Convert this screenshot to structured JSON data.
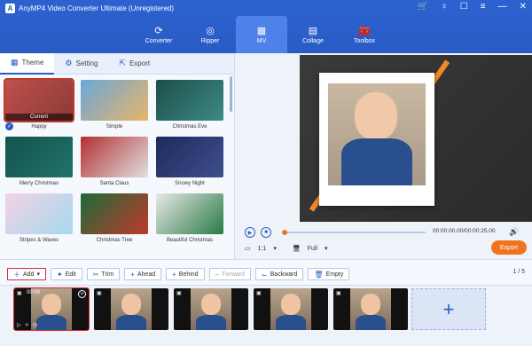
{
  "app": {
    "title": "AnyMP4 Video Converter Ultimate (Unregistered)",
    "logo_letter": "A"
  },
  "window_controls": [
    "cart-icon",
    "account-icon",
    "chat-icon",
    "menu-icon",
    "minimize-icon",
    "close-icon"
  ],
  "nav": {
    "items": [
      {
        "label": "Converter",
        "icon": "converter-icon"
      },
      {
        "label": "Ripper",
        "icon": "ripper-icon"
      },
      {
        "label": "MV",
        "icon": "mv-icon",
        "active": true
      },
      {
        "label": "Collage",
        "icon": "collage-icon"
      },
      {
        "label": "Toolbox",
        "icon": "toolbox-icon"
      }
    ]
  },
  "tabs": [
    {
      "label": "Theme",
      "active": true
    },
    {
      "label": "Setting"
    },
    {
      "label": "Export"
    }
  ],
  "themes": [
    {
      "name": "Happy",
      "current": true,
      "current_label": "Current",
      "colors": [
        "#c0504d",
        "#8a3a35"
      ]
    },
    {
      "name": "Simple",
      "colors": [
        "#6aa7d8",
        "#e8b56a"
      ]
    },
    {
      "name": "Christmas Eve",
      "colors": [
        "#1e4d4a",
        "#3d8b84"
      ]
    },
    {
      "name": "Merry Christmas",
      "colors": [
        "#15524d",
        "#1f7369"
      ]
    },
    {
      "name": "Santa Claus",
      "colors": [
        "#b23030",
        "#e0e0e0"
      ]
    },
    {
      "name": "Snowy Night",
      "colors": [
        "#1f2a5a",
        "#3e4f8f"
      ]
    },
    {
      "name": "Stripes & Waves",
      "colors": [
        "#f3d3e4",
        "#a6d8ef"
      ]
    },
    {
      "name": "Christmas Tree",
      "colors": [
        "#1b6b3a",
        "#c0392b"
      ]
    },
    {
      "name": "Beautiful Christmas",
      "colors": [
        "#e8e8e8",
        "#2a7a45"
      ]
    }
  ],
  "player": {
    "time": "00:00:00.00/00:00:25.00",
    "ratio": "1:1",
    "display": "Full",
    "export_label": "Export",
    "progress": 0
  },
  "toolbar": {
    "add": "Add",
    "edit": "Edit",
    "trim": "Trim",
    "ahead": "Ahead",
    "behind": "Behind",
    "forward": "Forward",
    "backward": "Backward",
    "empty": "Empty",
    "page": "1 / 5"
  },
  "timeline": {
    "first_clip_time": "00:00"
  },
  "colors": {
    "accent": "#2a5bc4",
    "orange": "#f0741f",
    "selection": "#d32f2f"
  }
}
